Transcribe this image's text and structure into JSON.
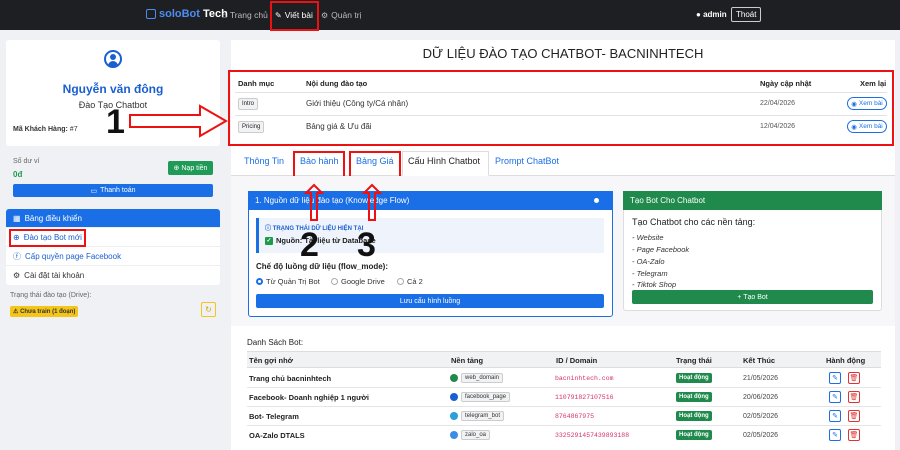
{
  "nav": {
    "brand_part1": "soloBot",
    "brand_part2": "Tech",
    "home": "Trang chủ",
    "write_post": "Viết bài",
    "admin_panel": "Quản trị",
    "user": "admin",
    "logout": "Thoát"
  },
  "sidebar": {
    "name": "Nguyễn văn đông",
    "role": "Đào Tạo Chatbot",
    "customer_code_label": "Mã Khách Hàng:",
    "customer_code": "#7",
    "balance_label": "Số dư ví",
    "balance_value": "0đ",
    "topup_label": "Nạp tiền",
    "pay_label": "Thanh toán",
    "menu": [
      {
        "label": "Bảng điều khiển"
      },
      {
        "label": "Đào tạo Bot mới"
      },
      {
        "label": "Cấp quyền page Facebook"
      },
      {
        "label": "Cài đặt tài khoản"
      }
    ],
    "drive_label": "Trạng thái đào tạo (Drive):",
    "drive_badge": "Chưa train (1 đoạn)"
  },
  "main": {
    "title": "DỮ LIỆU ĐÀO TẠO CHATBOT- BACNINHTECH",
    "training_table": {
      "headers": [
        "Danh mục",
        "Nội dung đào tạo",
        "Ngày cập nhật",
        "Xem lại"
      ],
      "rows": [
        {
          "tag": "Intro",
          "content": "Giới thiệu (Công ty/Cá nhân)",
          "date": "22/04/2026",
          "action": "Xem bài"
        },
        {
          "tag": "Pricing",
          "content": "Bảng giá & Ưu đãi",
          "date": "12/04/2026",
          "action": "Xem bài"
        }
      ]
    },
    "tabs": [
      "Thông Tin",
      "Bảo hành",
      "Bảng Giá",
      "Cấu Hình Chatbot",
      "Prompt ChatBot"
    ],
    "knowledge": {
      "header": "1. Nguồn dữ liệu đào tạo (Knowledge Flow)",
      "status_title": "TRẠNG THÁI DỮ LIỆU HIỆN TẠI",
      "status_value": "Nguồn: Tài liệu từ Database",
      "flow_label": "Chế độ luồng dữ liệu (flow_mode):",
      "options": [
        "Từ Quản Trị Bot",
        "Google Drive",
        "Cả 2"
      ],
      "save_label": "Lưu cấu hình luồng"
    },
    "create_bot": {
      "header": "Tạo Bot Cho Chatbot",
      "title": "Tạo Chatbot cho các nền tảng:",
      "items": [
        "- Website",
        "- Page Facebook",
        "- OA-Zalo",
        "- Telegram",
        "- Tiktok Shop"
      ],
      "button": "+ Tạo Bot"
    },
    "bots": {
      "label": "Danh Sách Bot:",
      "headers": [
        "Tên gợi nhớ",
        "Nền tảng",
        "ID / Domain",
        "Trạng thái",
        "Kết Thúc",
        "Hành động"
      ],
      "rows": [
        {
          "name": "Trang chủ bacninhtech",
          "platform": "web_domain",
          "platform_color": "#1f8a4c",
          "domain": "bacninhtech.com",
          "status": "Hoạt động",
          "end": "21/05/2026"
        },
        {
          "name": "Facebook- Doanh nghiệp 1 người",
          "platform": "facebook_page",
          "platform_color": "#1a5fd0",
          "domain": "110791827107516",
          "status": "Hoạt động",
          "end": "20/06/2026"
        },
        {
          "name": "Bot- Telegram",
          "platform": "telegram_bot",
          "platform_color": "#2a9fd8",
          "domain": "8764867975",
          "status": "Hoạt động",
          "end": "02/05/2026"
        },
        {
          "name": "OA-Zalo DTALS",
          "platform": "zalo_oa",
          "platform_color": "#3b8ee6",
          "domain": "3325291457439893188",
          "status": "Hoạt động",
          "end": "02/05/2026"
        }
      ]
    }
  },
  "annotations": [
    "1",
    "2",
    "3"
  ],
  "colors": {
    "accent": "#1a6fe6",
    "success": "#1f8a4c",
    "highlight": "#e11111"
  }
}
